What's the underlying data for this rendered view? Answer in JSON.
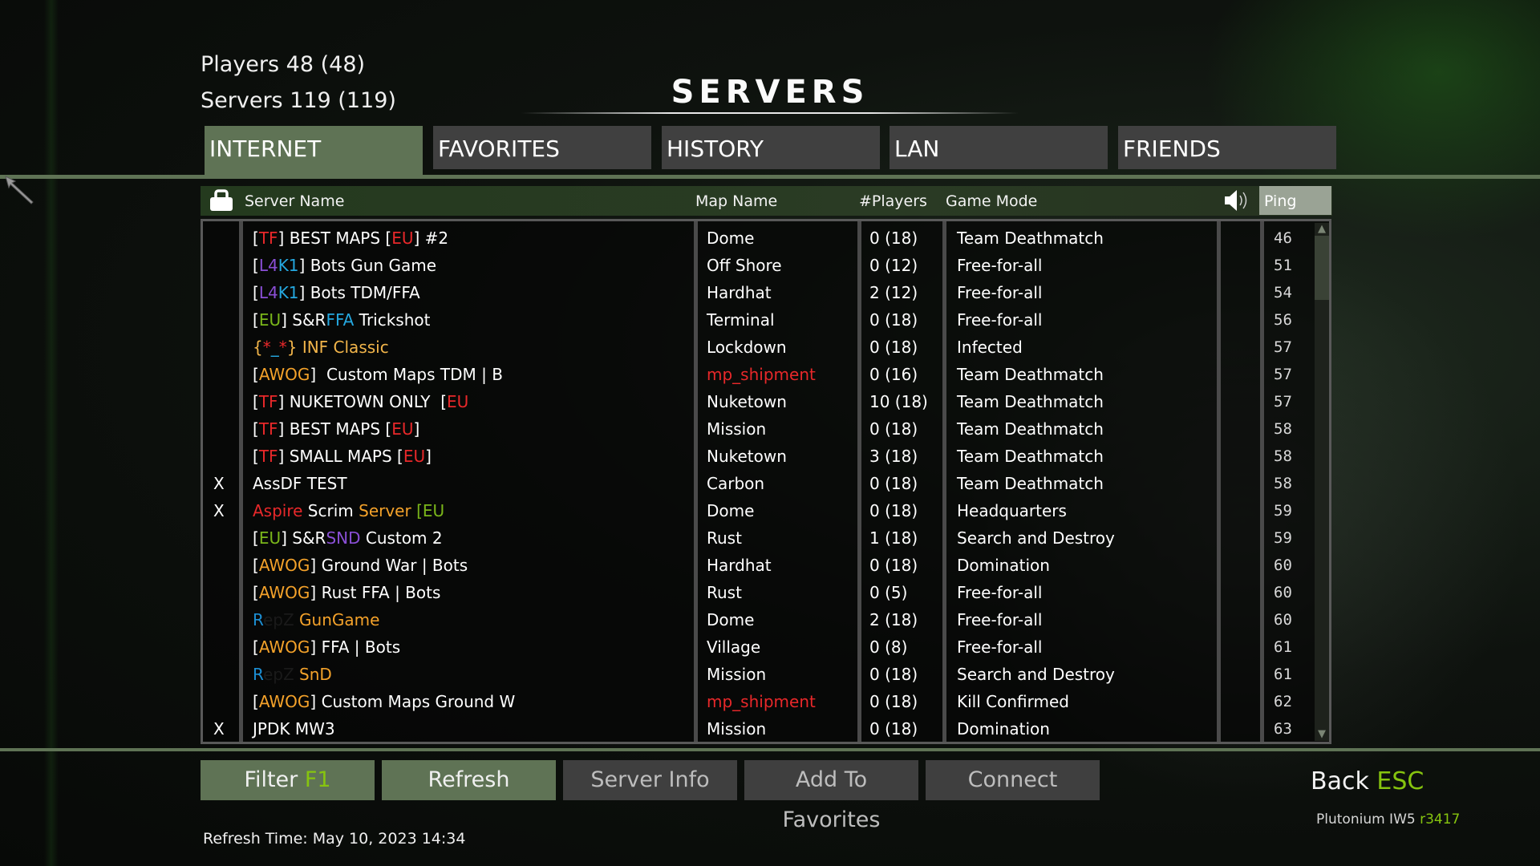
{
  "header": {
    "players_label": "Players 48 (48)",
    "servers_label": "Servers 119 (119)",
    "title": "SERVERS"
  },
  "tabs": [
    {
      "label": "INTERNET",
      "active": true
    },
    {
      "label": "FAVORITES",
      "active": false
    },
    {
      "label": "HISTORY",
      "active": false
    },
    {
      "label": "LAN",
      "active": false
    },
    {
      "label": "FRIENDS",
      "active": false
    }
  ],
  "columns": {
    "lock_icon": "lock-icon",
    "server_name": "Server Name",
    "map_name": "Map Name",
    "players": "#Players",
    "game_mode": "Game Mode",
    "sound_icon": "speaker-icon",
    "ping": "Ping"
  },
  "colors": {
    "accent_green": "#86c40f",
    "tab_active": "#5f7355",
    "tab_inactive": "#404040",
    "red": "#e8282a",
    "orange": "#f4a22a",
    "purple": "#8a4fd6",
    "cyan": "#25a8e0",
    "green": "#7ab61a",
    "yellow": "#f2b54a",
    "blue": "#1c8fd4",
    "dark": "#1a1a1a"
  },
  "rows": [
    {
      "locked": "",
      "name": [
        [
          "[",
          "#fff"
        ],
        [
          "TF",
          "#e8282a"
        ],
        [
          "] BEST MAPS [",
          "#fff"
        ],
        [
          "EU",
          "#e8282a"
        ],
        [
          "] #2",
          "#fff"
        ]
      ],
      "map": "Dome",
      "map_color": "#fff",
      "players": "0 (18)",
      "mode": "Team Deathmatch",
      "ping": "46"
    },
    {
      "locked": "",
      "name": [
        [
          "[",
          "#fff"
        ],
        [
          "L4",
          "#8a4fd6"
        ],
        [
          "K1",
          "#25a8e0"
        ],
        [
          "] Bots Gun Game",
          "#fff"
        ]
      ],
      "map": "Off Shore",
      "map_color": "#fff",
      "players": "0 (12)",
      "mode": "Free-for-all",
      "ping": "51"
    },
    {
      "locked": "",
      "name": [
        [
          "[",
          "#fff"
        ],
        [
          "L4",
          "#8a4fd6"
        ],
        [
          "K1",
          "#25a8e0"
        ],
        [
          "] Bots TDM/FFA",
          "#fff"
        ]
      ],
      "map": "Hardhat",
      "map_color": "#fff",
      "players": "2 (12)",
      "mode": "Free-for-all",
      "ping": "54"
    },
    {
      "locked": "",
      "name": [
        [
          "[",
          "#fff"
        ],
        [
          "EU",
          "#7ab61a"
        ],
        [
          "] S&R",
          "#fff"
        ],
        [
          "FFA",
          "#25a8e0"
        ],
        [
          " Trickshot",
          "#fff"
        ]
      ],
      "map": "Terminal",
      "map_color": "#fff",
      "players": "0 (18)",
      "mode": "Free-for-all",
      "ping": "56"
    },
    {
      "locked": "",
      "name": [
        [
          "{",
          "#f2b54a"
        ],
        [
          "*",
          "#e8282a"
        ],
        [
          "_",
          "#25a8e0"
        ],
        [
          "*",
          "#e8282a"
        ],
        [
          "} INF Classic",
          "#f2b54a"
        ]
      ],
      "map": "Lockdown",
      "map_color": "#fff",
      "players": "0 (18)",
      "mode": "Infected",
      "ping": "57"
    },
    {
      "locked": "",
      "name": [
        [
          "[",
          "#fff"
        ],
        [
          "AWOG",
          "#f4a22a"
        ],
        [
          "]  Custom Maps TDM | B",
          "#fff"
        ]
      ],
      "map": "mp_shipment",
      "map_color": "#e8282a",
      "players": "0 (16)",
      "mode": "Team Deathmatch",
      "ping": "57"
    },
    {
      "locked": "",
      "name": [
        [
          "[",
          "#fff"
        ],
        [
          "TF",
          "#e8282a"
        ],
        [
          "] NUKETOWN ONLY  [",
          "#fff"
        ],
        [
          "EU",
          "#e8282a"
        ]
      ],
      "map": "Nuketown",
      "map_color": "#fff",
      "players": "10 (18)",
      "mode": "Team Deathmatch",
      "ping": "57"
    },
    {
      "locked": "",
      "name": [
        [
          "[",
          "#fff"
        ],
        [
          "TF",
          "#e8282a"
        ],
        [
          "] BEST MAPS [",
          "#fff"
        ],
        [
          "EU",
          "#e8282a"
        ],
        [
          "]",
          "#fff"
        ]
      ],
      "map": "Mission",
      "map_color": "#fff",
      "players": "0 (18)",
      "mode": "Team Deathmatch",
      "ping": "58"
    },
    {
      "locked": "",
      "name": [
        [
          "[",
          "#fff"
        ],
        [
          "TF",
          "#e8282a"
        ],
        [
          "] SMALL MAPS [",
          "#fff"
        ],
        [
          "EU",
          "#e8282a"
        ],
        [
          "]",
          "#fff"
        ]
      ],
      "map": "Nuketown",
      "map_color": "#fff",
      "players": "3 (18)",
      "mode": "Team Deathmatch",
      "ping": "58"
    },
    {
      "locked": "X",
      "name": [
        [
          "AssDF TEST",
          "#fff"
        ]
      ],
      "map": "Carbon",
      "map_color": "#fff",
      "players": "0 (18)",
      "mode": "Team Deathmatch",
      "ping": "58"
    },
    {
      "locked": "X",
      "name": [
        [
          "Aspire",
          "#e8282a"
        ],
        [
          " Scrim ",
          "#fff"
        ],
        [
          "Server ",
          "#f4a22a"
        ],
        [
          "[EU",
          "#7ab61a"
        ]
      ],
      "map": "Dome",
      "map_color": "#fff",
      "players": "0 (18)",
      "mode": "Headquarters",
      "ping": "59"
    },
    {
      "locked": "",
      "name": [
        [
          "[",
          "#fff"
        ],
        [
          "EU",
          "#7ab61a"
        ],
        [
          "] S&R",
          "#fff"
        ],
        [
          "SND",
          "#8a4fd6"
        ],
        [
          " Custom 2",
          "#fff"
        ]
      ],
      "map": "Rust",
      "map_color": "#fff",
      "players": "1 (18)",
      "mode": "Search and Destroy",
      "ping": "59"
    },
    {
      "locked": "",
      "name": [
        [
          "[",
          "#fff"
        ],
        [
          "AWOG",
          "#f4a22a"
        ],
        [
          "] Ground War | Bots",
          "#fff"
        ]
      ],
      "map": "Hardhat",
      "map_color": "#fff",
      "players": "0 (18)",
      "mode": "Domination",
      "ping": "60"
    },
    {
      "locked": "",
      "name": [
        [
          "[",
          "#fff"
        ],
        [
          "AWOG",
          "#f4a22a"
        ],
        [
          "] Rust FFA | Bots",
          "#fff"
        ]
      ],
      "map": "Rust",
      "map_color": "#fff",
      "players": "0 (5)",
      "mode": "Free-for-all",
      "ping": "60"
    },
    {
      "locked": "",
      "name": [
        [
          "R",
          "#1c8fd4"
        ],
        [
          "epZ",
          "#1a1a1a"
        ],
        [
          " GunGame",
          "#f4a22a"
        ]
      ],
      "map": "Dome",
      "map_color": "#fff",
      "players": "2 (18)",
      "mode": "Free-for-all",
      "ping": "60"
    },
    {
      "locked": "",
      "name": [
        [
          "[",
          "#fff"
        ],
        [
          "AWOG",
          "#f4a22a"
        ],
        [
          "] FFA | Bots",
          "#fff"
        ]
      ],
      "map": "Village",
      "map_color": "#fff",
      "players": "0 (8)",
      "mode": "Free-for-all",
      "ping": "61"
    },
    {
      "locked": "",
      "name": [
        [
          "R",
          "#1c8fd4"
        ],
        [
          "epZ",
          "#1a1a1a"
        ],
        [
          " SnD",
          "#f4a22a"
        ]
      ],
      "map": "Mission",
      "map_color": "#fff",
      "players": "0 (18)",
      "mode": "Search and Destroy",
      "ping": "61"
    },
    {
      "locked": "",
      "name": [
        [
          "[",
          "#fff"
        ],
        [
          "AWOG",
          "#f4a22a"
        ],
        [
          "] Custom Maps Ground W",
          "#fff"
        ]
      ],
      "map": "mp_shipment",
      "map_color": "#e8282a",
      "players": "0 (18)",
      "mode": "Kill Confirmed",
      "ping": "62"
    },
    {
      "locked": "X",
      "name": [
        [
          "JPDK MW3",
          "#fff"
        ]
      ],
      "map": "Mission",
      "map_color": "#fff",
      "players": "0 (18)",
      "mode": "Domination",
      "ping": "63"
    }
  ],
  "buttons": {
    "filter": "Filter",
    "filter_key": "F1",
    "refresh": "Refresh",
    "server_info": "Server Info",
    "add_favorites": "Add To Favorites",
    "connect": "Connect"
  },
  "footer": {
    "refresh_time": "Refresh Time: May 10, 2023  14:34",
    "back": "Back",
    "back_key": "ESC",
    "version_name": "Plutonium IW5",
    "version_rev": "r3417"
  }
}
